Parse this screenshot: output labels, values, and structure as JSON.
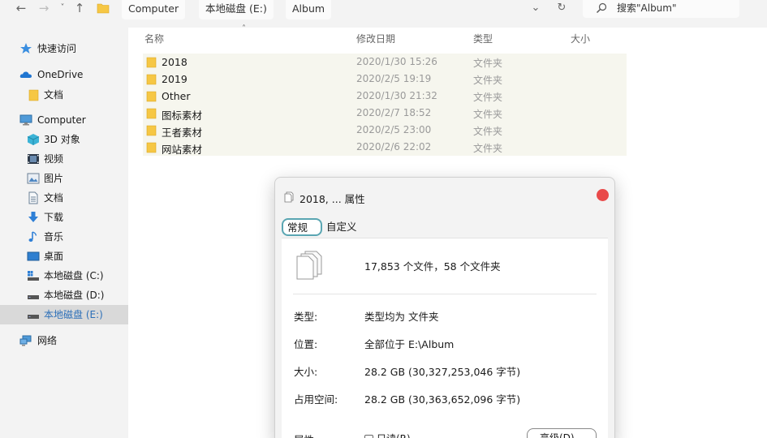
{
  "toolbar": {
    "back_glyph": "←",
    "forward_glyph": "→",
    "dropdown_glyph": "˅",
    "up_glyph": "↑",
    "expand_glyph": "⌄",
    "refresh_glyph": "↻"
  },
  "breadcrumb": [
    "Computer",
    "本地磁盘 (E:)",
    "Album"
  ],
  "search": {
    "text": "搜索\"Album\""
  },
  "sidebar": {
    "items": [
      {
        "label": "快速访问",
        "icon": "star-pin-icon"
      },
      {
        "label": "OneDrive",
        "icon": "cloud-icon"
      },
      {
        "label": "文档",
        "icon": "folder-icon"
      },
      {
        "label": "Computer",
        "icon": "computer-icon"
      },
      {
        "label": "3D 对象",
        "icon": "cube-icon"
      },
      {
        "label": "视频",
        "icon": "video-icon"
      },
      {
        "label": "图片",
        "icon": "picture-icon"
      },
      {
        "label": "文档",
        "icon": "document-icon"
      },
      {
        "label": "下载",
        "icon": "download-icon"
      },
      {
        "label": "音乐",
        "icon": "music-icon"
      },
      {
        "label": "桌面",
        "icon": "desktop-icon"
      },
      {
        "label": "本地磁盘 (C:)",
        "icon": "drive-icon"
      },
      {
        "label": "本地磁盘 (D:)",
        "icon": "drive-icon"
      },
      {
        "label": "本地磁盘 (E:)",
        "icon": "drive-icon"
      },
      {
        "label": "网络",
        "icon": "network-icon"
      }
    ]
  },
  "columns": {
    "name": "名称",
    "date": "修改日期",
    "type": "类型",
    "size": "大小",
    "sort_caret": "˄"
  },
  "files": [
    {
      "name": "2018",
      "date": "2020/1/30 15:26",
      "type": "文件夹"
    },
    {
      "name": "2019",
      "date": "2020/2/5 19:19",
      "type": "文件夹"
    },
    {
      "name": "Other",
      "date": "2020/1/30 21:32",
      "type": "文件夹"
    },
    {
      "name": "图标素材",
      "date": "2020/2/7 18:52",
      "type": "文件夹"
    },
    {
      "name": "王者素材",
      "date": "2020/2/5 23:00",
      "type": "文件夹"
    },
    {
      "name": "网站素材",
      "date": "2020/2/6 22:02",
      "type": "文件夹"
    }
  ],
  "dialog": {
    "title": "2018, ... 属性",
    "tabs": [
      "常规",
      "自定义"
    ],
    "count": "17,853 个文件，58 个文件夹",
    "props": [
      {
        "label": "类型:",
        "value": "类型均为 文件夹"
      },
      {
        "label": "位置:",
        "value": "全部位于 E:\\Album"
      },
      {
        "label": "大小:",
        "value": "28.2 GB (30,327,253,046 字节)"
      },
      {
        "label": "占用空间:",
        "value": "28.2 GB (30,363,652,096 字节)"
      }
    ],
    "attr_label": "属性:",
    "readonly_label": "只读(R)",
    "advanced_button": "高级(D)..."
  },
  "colors": {
    "selected_sidebar": "#d9d9d9",
    "selected_text": "#2c6fb8",
    "folder": "#f6c744",
    "close": "#e94a4a",
    "tab_border": "#5aa6b2"
  }
}
